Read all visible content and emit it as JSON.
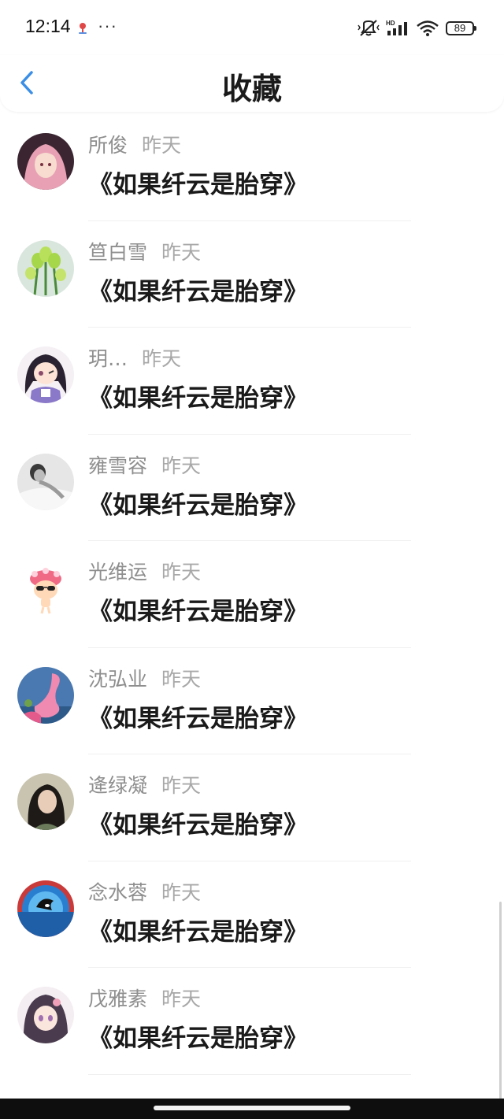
{
  "status_bar": {
    "time": "12:14",
    "dots": "···",
    "network_label": "HD",
    "battery": "89"
  },
  "header": {
    "title": "收藏"
  },
  "favorites": [
    {
      "name": "所俊",
      "time": "昨天",
      "book": "《如果纤云是胎穿》",
      "avatar": "pink-haired-anime-avatar"
    },
    {
      "name": "笪白雪",
      "time": "昨天",
      "book": "《如果纤云是胎穿》",
      "avatar": "green-tulips-avatar"
    },
    {
      "name": "玥…",
      "time": "昨天",
      "book": "《如果纤云是胎穿》",
      "avatar": "chibi-anime-avatar"
    },
    {
      "name": "雍雪容",
      "time": "昨天",
      "book": "《如果纤云是胎穿》",
      "avatar": "grayscale-photo-avatar"
    },
    {
      "name": "光维运",
      "time": "昨天",
      "book": "《如果纤云是胎穿》",
      "avatar": "cartoon-sunglasses-avatar"
    },
    {
      "name": "沈弘业",
      "time": "昨天",
      "book": "《如果纤云是胎穿》",
      "avatar": "pink-flamingo-avatar"
    },
    {
      "name": "逄绿凝",
      "time": "昨天",
      "book": "《如果纤云是胎穿》",
      "avatar": "portrait-photo-avatar"
    },
    {
      "name": "念水蓉",
      "time": "昨天",
      "book": "《如果纤云是胎穿》",
      "avatar": "blue-orca-avatar"
    },
    {
      "name": "戊雅素",
      "time": "昨天",
      "book": "《如果纤云是胎穿》",
      "avatar": "purple-haired-anime-avatar"
    }
  ],
  "colors": {
    "accent_blue": "#3a8ee6",
    "title_text": "#1a1a1a",
    "meta_text": "#8e8e8e",
    "divider": "#f0f0f0"
  }
}
